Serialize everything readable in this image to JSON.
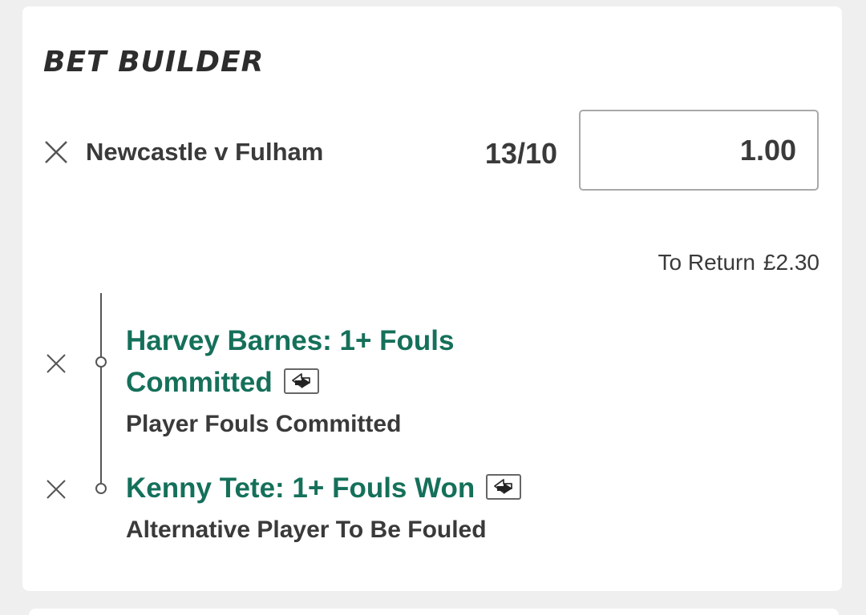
{
  "bet_builder": {
    "title": "BET BUILDER",
    "event_name": "Newcastle v Fulham",
    "odds": "13/10",
    "stake_value": "1.00",
    "to_return_label": "To Return",
    "to_return_value": "£2.30",
    "selections": [
      {
        "title_line1": "Harvey Barnes: 1+ Fouls",
        "title_line2": "Committed",
        "market": "Player Fouls Committed",
        "icon": "swap-icon"
      },
      {
        "title_line1": "Kenny Tete: 1+ Fouls Won",
        "market": "Alternative Player To Be Fouled",
        "icon": "swap-icon"
      }
    ]
  },
  "colors": {
    "selection_green": "#15705a",
    "text_dark": "#3a3a3a",
    "page_background": "#efefef",
    "card_background": "#ffffff"
  }
}
